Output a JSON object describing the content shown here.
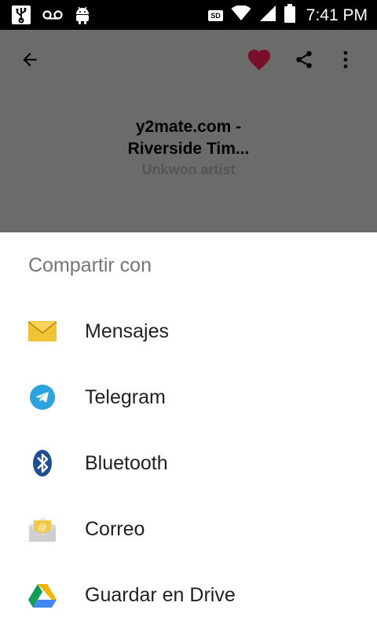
{
  "status_bar": {
    "left_icons": [
      "usb-icon",
      "voicemail-icon",
      "android-icon"
    ],
    "right_icons": [
      "sd-card-icon",
      "wifi-icon",
      "signal-icon",
      "battery-icon"
    ],
    "sd_label": "SD",
    "time": "7:41 PM"
  },
  "app": {
    "toolbar_icons": [
      "back-arrow-icon",
      "heart-icon",
      "share-icon",
      "more-vert-icon"
    ],
    "title_line1": "y2mate.com -",
    "title_line2": "Riverside Tim...",
    "artist": "Unkwon artist",
    "colors": {
      "scrim": "#6b6b6b",
      "heart": "#7a0f2c"
    }
  },
  "share_sheet": {
    "title": "Compartir con",
    "targets": [
      {
        "label": "Mensajes",
        "icon": "envelope-icon"
      },
      {
        "label": "Telegram",
        "icon": "telegram-icon"
      },
      {
        "label": "Bluetooth",
        "icon": "bluetooth-icon"
      },
      {
        "label": "Correo",
        "icon": "mail-icon"
      },
      {
        "label": "Guardar en Drive",
        "icon": "drive-icon"
      }
    ]
  }
}
